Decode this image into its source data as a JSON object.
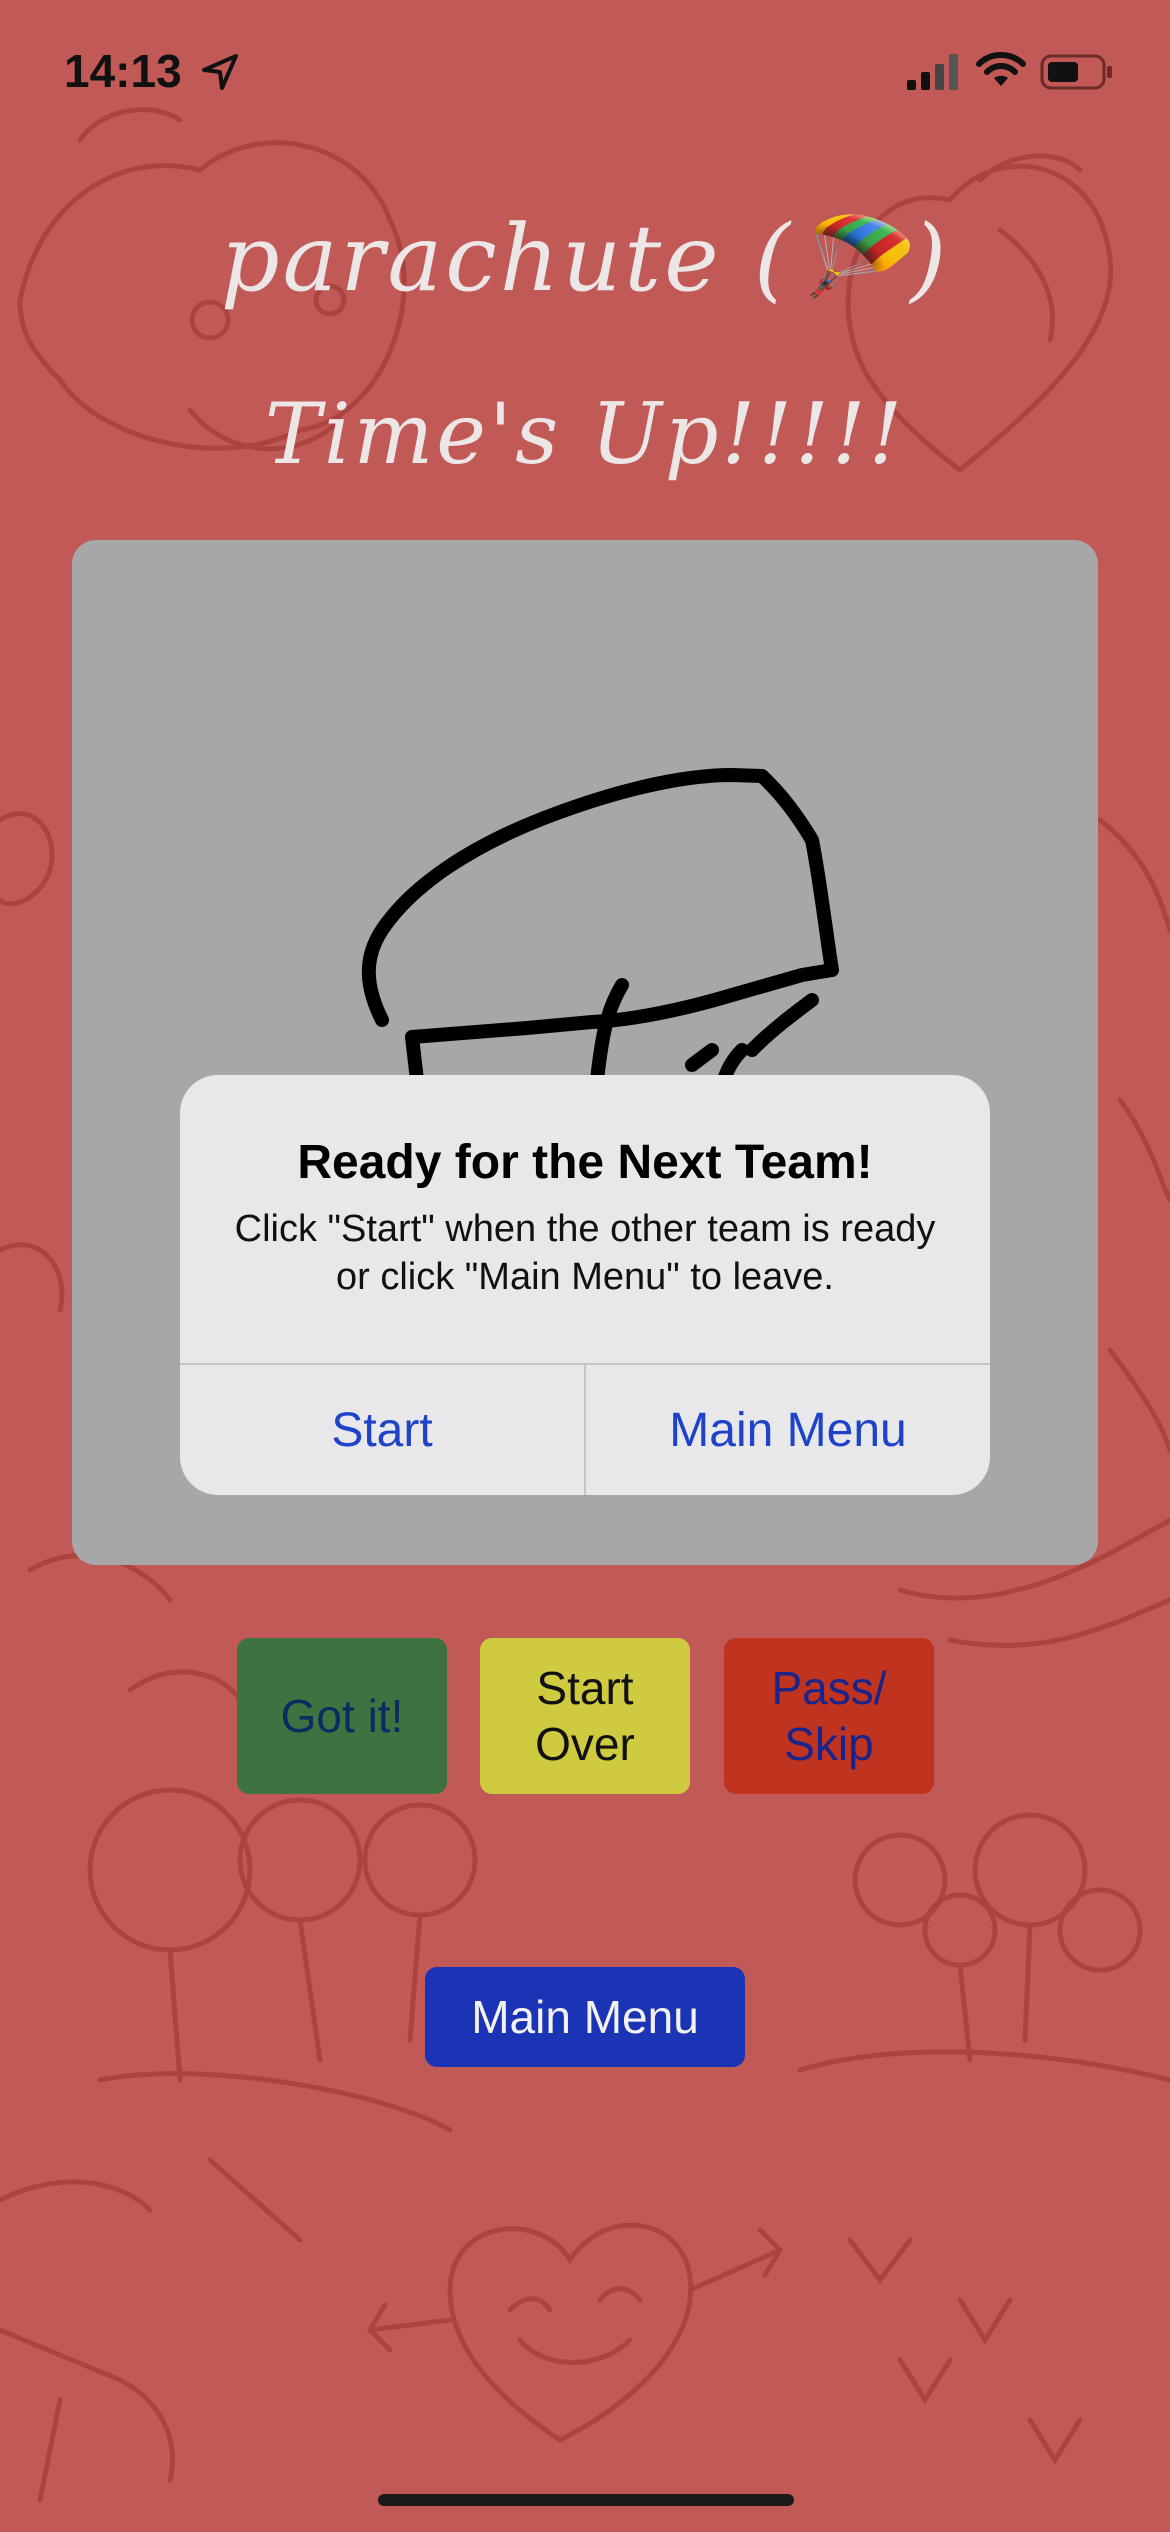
{
  "status_bar": {
    "time": "14:13",
    "location_icon": "location-arrow-icon",
    "signal_icon": "cellular-signal-icon",
    "wifi_icon": "wifi-icon",
    "battery_icon": "battery-icon"
  },
  "header": {
    "app_title": "parachute (🪂)",
    "sub_title": "Time's Up!!!!!"
  },
  "alert": {
    "title": "Ready for the Next Team!",
    "message": "Click \"Start\" when the other team is ready or click \"Main Menu\" to leave.",
    "start_label": "Start",
    "main_menu_label": "Main Menu"
  },
  "actions": {
    "got_it_label": "Got it!",
    "start_over_label": "Start Over",
    "pass_skip_label": "Pass/ Skip"
  },
  "footer": {
    "main_menu_label": "Main Menu"
  },
  "colors": {
    "background": "#c15a56",
    "canvas": "#a7a7a9",
    "alert_button_text": "#1e43c8",
    "got_it": "#3c7340",
    "start_over": "#cfcb40",
    "pass_skip": "#c0331f",
    "main_menu": "#1b33b5"
  }
}
